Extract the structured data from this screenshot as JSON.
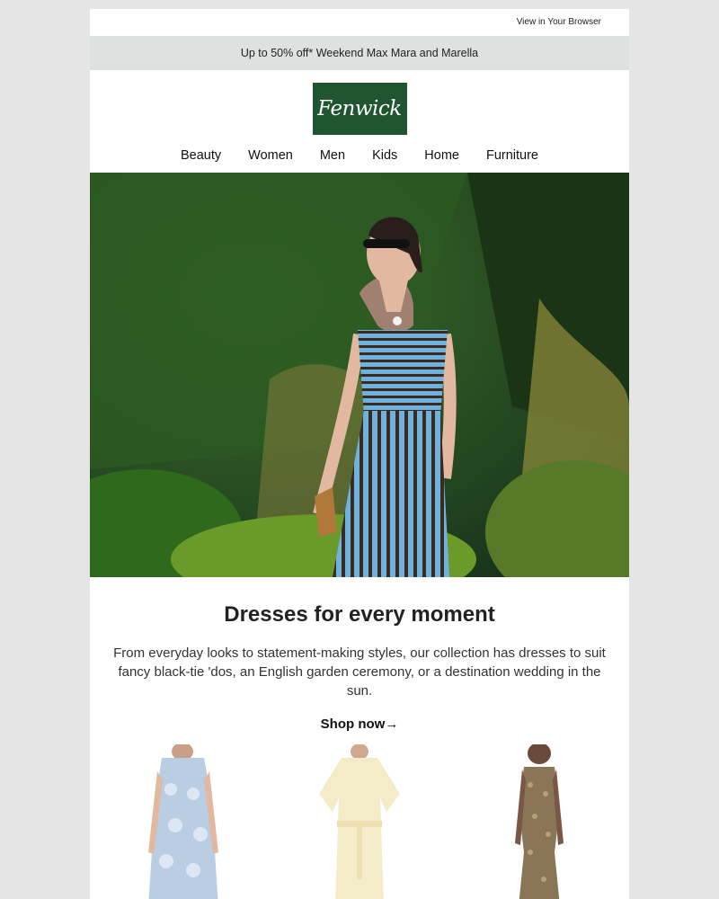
{
  "topbar": {
    "view_browser": "View in Your Browser"
  },
  "promo": {
    "text": "Up to 50% off* Weekend Max Mara and Marella"
  },
  "logo": {
    "text": "Fenwick",
    "color": "#1f5631"
  },
  "nav": {
    "items": [
      "Beauty",
      "Women",
      "Men",
      "Kids",
      "Home",
      "Furniture"
    ]
  },
  "feature": {
    "headline": "Dresses for every moment",
    "body": "From everyday looks to statement-making styles, our collection has dresses to suit fancy black-tie 'dos, an English garden ceremony, or a destination wedding in the sun.",
    "cta": "Shop now→"
  },
  "products": [
    {
      "name": "blue-lace-shift-dress"
    },
    {
      "name": "cream-belted-dress"
    },
    {
      "name": "gold-sequin-gown"
    }
  ]
}
